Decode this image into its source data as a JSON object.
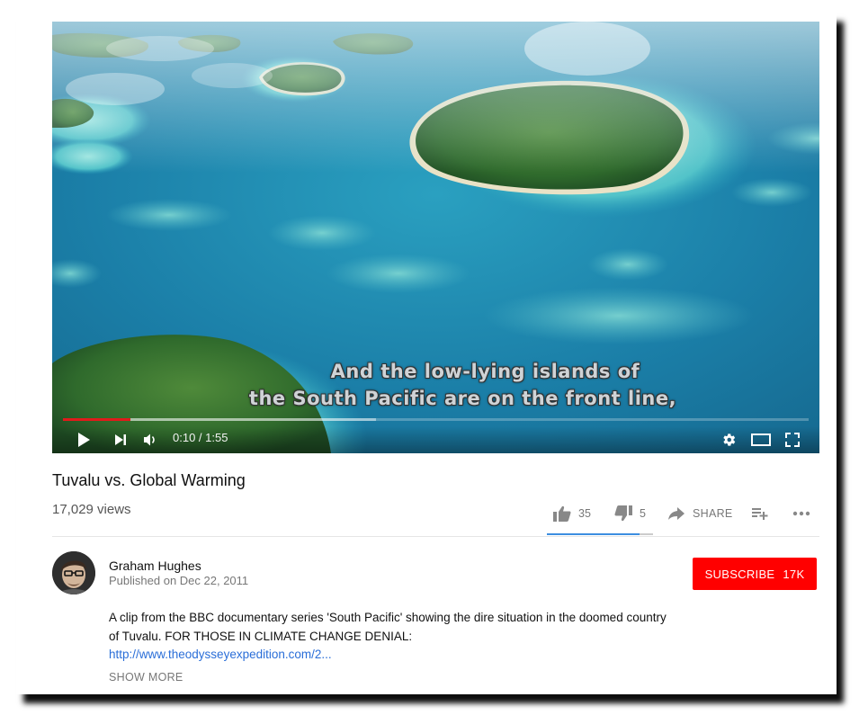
{
  "video": {
    "subtitle_line1": "And the low-lying islands of",
    "subtitle_line2": "the South Pacific are on the front line,",
    "time_display": "0:10 / 1:55",
    "progress_played_fraction": 0.09,
    "progress_buffered_fraction": 0.42
  },
  "info": {
    "title": "Tuvalu vs. Global Warming",
    "views": "17,029 views",
    "likes": "35",
    "dislikes": "5",
    "share_label": "SHARE",
    "like_ratio": 0.87
  },
  "channel": {
    "name": "Graham Hughes",
    "published": "Published on Dec 22, 2011",
    "subscribe_label": "SUBSCRIBE",
    "subscriber_count": "17K"
  },
  "description": {
    "text": "A clip from the BBC documentary series 'South Pacific' showing the dire situation in the doomed country of Tuvalu. FOR THOSE IN CLIMATE CHANGE DENIAL:",
    "link": "http://www.theodysseyexpedition.com/2...",
    "show_more": "SHOW MORE"
  },
  "icons": {
    "play": "play-icon",
    "next": "next-icon",
    "volume": "volume-icon",
    "settings": "gear-icon",
    "theater": "theater-mode-icon",
    "fullscreen": "fullscreen-icon",
    "like": "thumbs-up-icon",
    "dislike": "thumbs-down-icon",
    "share": "share-icon",
    "add_to_playlist": "add-to-playlist-icon",
    "more": "more-horizontal-icon"
  },
  "colors": {
    "accent_red": "#ff0000",
    "progress_red": "#e01b1b",
    "link_blue": "#2a6ed8",
    "like_bar_blue": "#3d8ee0"
  }
}
